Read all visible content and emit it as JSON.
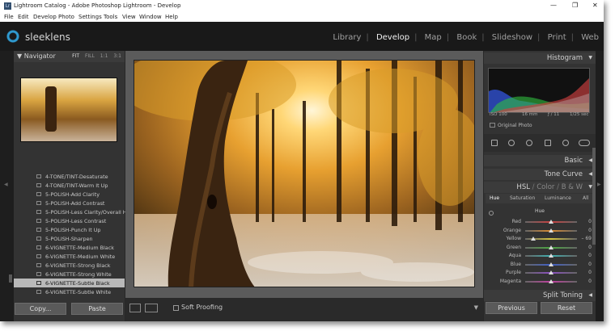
{
  "window": {
    "title": "Lightroom Catalog - Adobe Photoshop Lightroom - Develop",
    "app_icon_letters": "Lr",
    "minimize_icon": "minimize-icon",
    "maximize_icon": "maximize-icon",
    "close_icon": "close-icon"
  },
  "menu": [
    "File",
    "Edit",
    "Develop",
    "Photo",
    "Settings",
    "Tools",
    "View",
    "Window",
    "Help"
  ],
  "identity": {
    "logo_text": "sleeklens"
  },
  "modules": {
    "items": [
      "Library",
      "Develop",
      "Map",
      "Book",
      "Slideshow",
      "Print",
      "Web"
    ],
    "active": "Develop",
    "separator": "|"
  },
  "navigator": {
    "title": "Navigator",
    "zoom_options": [
      "FIT",
      "FILL",
      "1:1",
      "3:1"
    ],
    "active_zoom": "FIT"
  },
  "presets": {
    "items": [
      "4-TONE/TINT-Desaturate",
      "4-TONE/TINT-Warm It Up",
      "5-POLISH-Add Clarity",
      "5-POLISH-Add Contrast",
      "5-POLISH-Less Clarity/Overall H...",
      "5-POLISH-Less Contrast",
      "5-POLISH-Punch It Up",
      "5-POLISH-Sharpen",
      "6-VIGNETTE-Medium Black",
      "6-VIGNETTE-Medium White",
      "6-VIGNETTE-Strong Black",
      "6-VIGNETTE-Strong White",
      "6-VIGNETTE-Subtle Black",
      "6-VIGNETTE-Subtle White"
    ],
    "selected_index": 12
  },
  "left_buttons": {
    "copy": "Copy...",
    "paste": "Paste"
  },
  "toolbar": {
    "soft_proofing": "Soft Proofing"
  },
  "histogram": {
    "title": "Histogram",
    "iso": "ISO 100",
    "focal": "16 mm",
    "aperture": "ƒ / 11",
    "shutter": "1/25 sec",
    "original_photo": "Original Photo"
  },
  "panels": {
    "basic": "Basic",
    "tone_curve": "Tone Curve",
    "split_toning": "Split Toning"
  },
  "hsl": {
    "header_hsl": "HSL",
    "header_slash": "/",
    "header_color": "Color",
    "header_bw": "B & W",
    "tabs": [
      "Hue",
      "Saturation",
      "Luminance",
      "All"
    ],
    "active_tab": "Hue",
    "subhead": "Hue",
    "rows": [
      {
        "label": "Red",
        "value": "0",
        "level": 0,
        "color": "#c84040"
      },
      {
        "label": "Orange",
        "value": "0",
        "level": 0,
        "color": "#d88a30"
      },
      {
        "label": "Yellow",
        "value": "– 69",
        "level": -69,
        "color": "#d6c640"
      },
      {
        "label": "Green",
        "value": "0",
        "level": 0,
        "color": "#4aa840"
      },
      {
        "label": "Aqua",
        "value": "0",
        "level": 0,
        "color": "#40b0b0"
      },
      {
        "label": "Blue",
        "value": "0",
        "level": 0,
        "color": "#4060c8"
      },
      {
        "label": "Purple",
        "value": "0",
        "level": 0,
        "color": "#8a50c0"
      },
      {
        "label": "Magenta",
        "value": "0",
        "level": 0,
        "color": "#c040a0"
      }
    ]
  },
  "right_buttons": {
    "previous": "Previous",
    "reset": "Reset"
  }
}
